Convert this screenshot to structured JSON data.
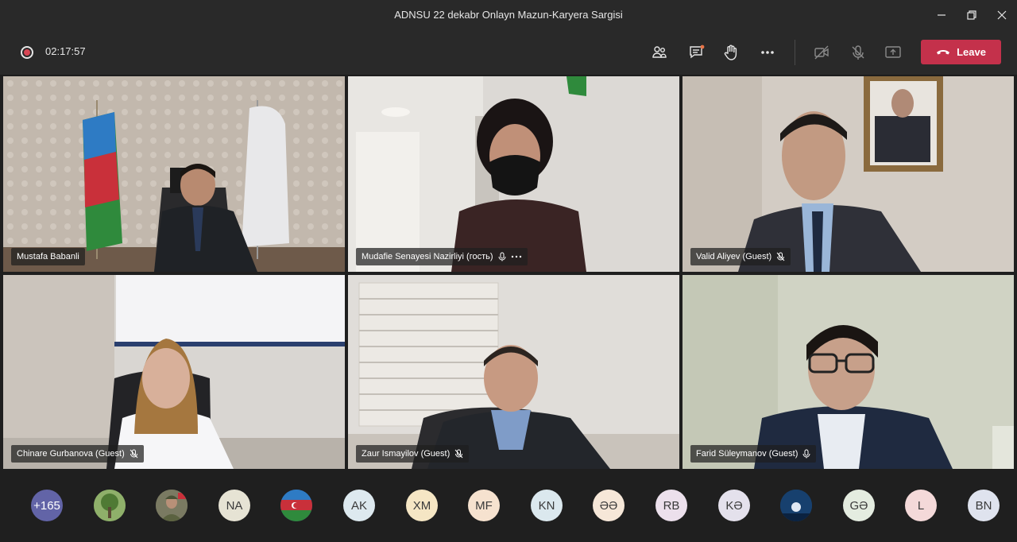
{
  "window": {
    "title": "ADNSU 22 dekabr Onlayn Mazun-Karyera Sargisi",
    "controls": [
      "minimize-icon",
      "restore-icon",
      "close-icon"
    ]
  },
  "toolbar": {
    "recording_time": "02:17:57",
    "buttons": [
      "participants-icon",
      "chat-icon",
      "raise-hand-icon",
      "more-icon",
      "camera-off-icon",
      "mic-off-icon",
      "share-screen-icon"
    ],
    "leave_label": "Leave",
    "leave_color": "#c4314b"
  },
  "participants": [
    {
      "name": "Mustafa Babanli"
    },
    {
      "name": "Mudafie Senayesi Nazirliyi (гость)"
    },
    {
      "name": "Valid Aliyev (Guest)"
    },
    {
      "name": "Chinare Gurbanova (Guest)"
    },
    {
      "name": "Zaur Ismayilov (Guest)"
    },
    {
      "name": "Farid Süleymanov (Guest)"
    }
  ],
  "tray": [
    {
      "label": "+165",
      "bg": "#6264a7",
      "fg": "#ffffff"
    },
    {
      "label": "",
      "bg": "#5a7a4a",
      "fg": "#ffffff",
      "picture": "tree-photo"
    },
    {
      "label": "",
      "bg": "#6b6a55",
      "fg": "#ffffff",
      "picture": "soldier-photo"
    },
    {
      "label": "NA",
      "bg": "#e6e3d4",
      "fg": "#3a3a3a"
    },
    {
      "label": "",
      "bg": "#3a5fa0",
      "fg": "#ffffff",
      "picture": "flag-photo"
    },
    {
      "label": "AK",
      "bg": "#dde9ef",
      "fg": "#3a3a3a"
    },
    {
      "label": "XM",
      "bg": "#f5e6c4",
      "fg": "#3a3a3a"
    },
    {
      "label": "MF",
      "bg": "#f6e2cf",
      "fg": "#3a3a3a"
    },
    {
      "label": "KN",
      "bg": "#dbe8ee",
      "fg": "#3a3a3a"
    },
    {
      "label": "ƏƏ",
      "bg": "#f6e7d8",
      "fg": "#3a3a3a"
    },
    {
      "label": "RB",
      "bg": "#ece0ec",
      "fg": "#3a3a3a"
    },
    {
      "label": "KƏ",
      "bg": "#e4e1ec",
      "fg": "#3a3a3a"
    },
    {
      "label": "",
      "bg": "#1b4a7a",
      "fg": "#ffffff",
      "picture": "night-photo"
    },
    {
      "label": "GƏ",
      "bg": "#e4ece0",
      "fg": "#3a3a3a"
    },
    {
      "label": "L",
      "bg": "#f4d9d9",
      "fg": "#3a3a3a"
    },
    {
      "label": "BN",
      "bg": "#dfe3ee",
      "fg": "#3a3a3a"
    }
  ]
}
